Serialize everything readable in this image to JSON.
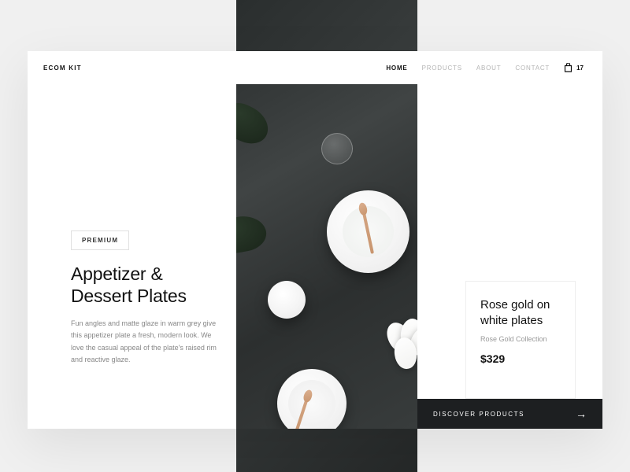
{
  "brand": "ECOM KIT",
  "nav": {
    "items": [
      {
        "label": "HOME",
        "active": true
      },
      {
        "label": "PRODUCTS",
        "active": false
      },
      {
        "label": "ABOUT",
        "active": false
      },
      {
        "label": "CONTACT",
        "active": false
      }
    ],
    "cart_count": "17"
  },
  "hero": {
    "badge": "PREMIUM",
    "title": "Appetizer & Dessert Plates",
    "description": "Fun angles and matte glaze in warm grey give this appetizer plate a fresh, modern look. We love the casual appeal of the plate's raised rim and reactive glaze."
  },
  "product": {
    "title": "Rose gold on white plates",
    "collection": "Rose Gold Collection",
    "price": "$329"
  },
  "cta": {
    "label": "DISCOVER PRODUCTS"
  }
}
